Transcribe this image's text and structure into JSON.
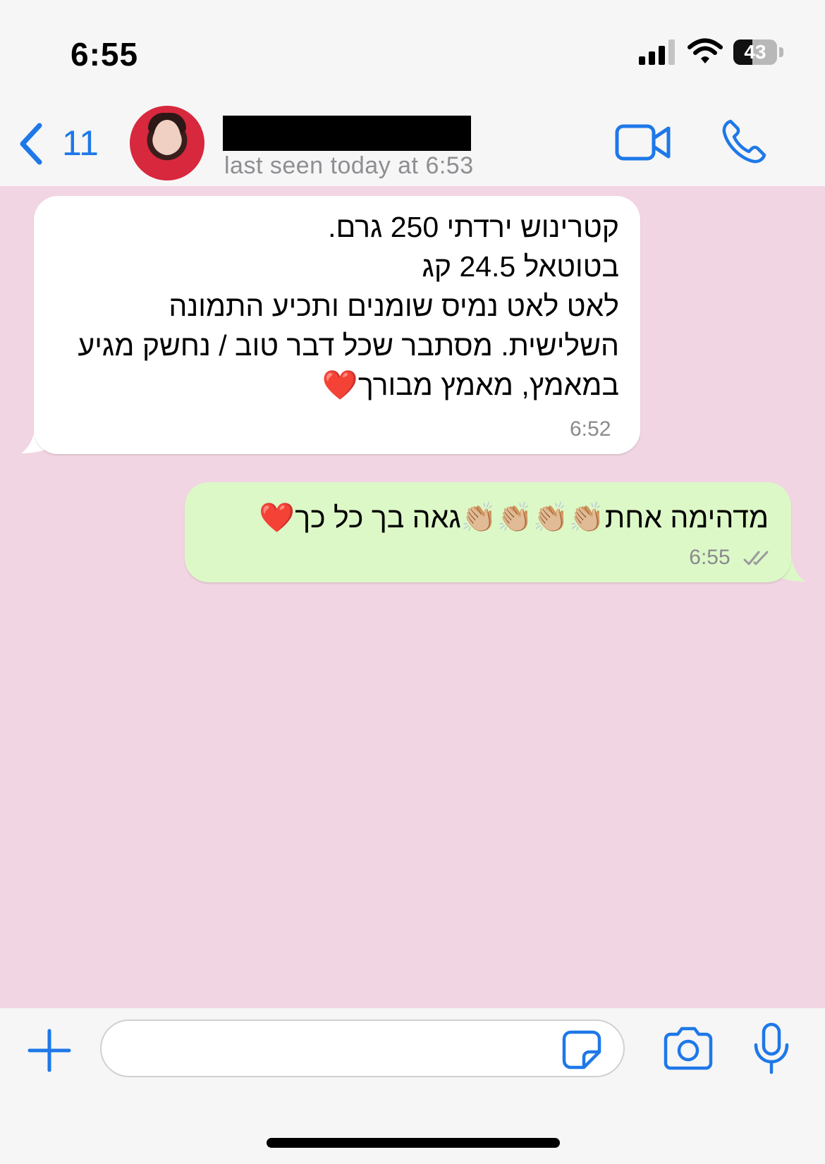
{
  "status_bar": {
    "time": "6:55",
    "battery_level": "43",
    "battery_fraction": 0.43
  },
  "header": {
    "back_count": "11",
    "contact_name": "",
    "last_seen": "last seen today at 6:53"
  },
  "messages": [
    {
      "direction": "incoming",
      "text": "קטרינוש ירדתי 250 גרם.\nבטוטאל 24.5 קג\nלאט לאט נמיס שומנים ותכיע  התמונה השלישית. מסתבר שכל דבר טוב / נחשק מגיע במאמץ, מאמץ מבורך❤️",
      "time": "6:52"
    },
    {
      "direction": "outgoing",
      "text": "מדהימה אחת👏🏼👏🏼👏🏼👏🏼גאה בך כל כך❤️",
      "time": "6:55",
      "status": "read"
    }
  ],
  "composer": {
    "placeholder": "",
    "value": ""
  },
  "colors": {
    "accent": "#1e78e8",
    "chat_background": "#f2d5e2",
    "incoming_bubble": "#ffffff",
    "outgoing_bubble": "#dcf8c7"
  }
}
